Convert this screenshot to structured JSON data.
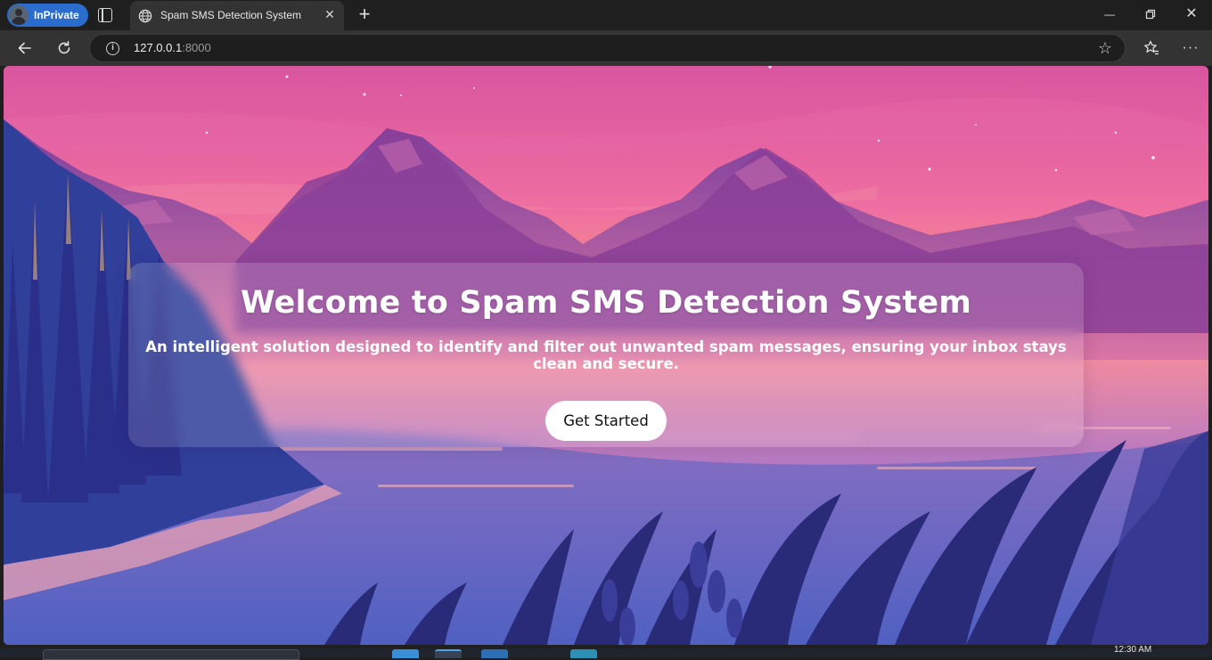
{
  "browser": {
    "inprivate_label": "InPrivate",
    "tab_title": "Spam SMS Detection System",
    "address": {
      "host": "127.0.0.1",
      "port": ":8000"
    }
  },
  "hero": {
    "title": "Welcome to Spam SMS Detection System",
    "subtitle": "An intelligent solution designed to identify and filter out unwanted spam messages, ensuring your inbox stays clean and secure.",
    "cta_label": "Get Started"
  },
  "taskbar": {
    "clock": "12:30 AM"
  },
  "icons": [
    "globe-icon",
    "close-icon",
    "plus-icon",
    "minimize-icon",
    "restore-icon",
    "back-icon",
    "refresh-icon",
    "info-icon",
    "star-icon",
    "favorites-icon",
    "more-icon"
  ],
  "colors": {
    "accent": "#2a6dcf",
    "sky_top": "#e45fa0",
    "sky_horizon": "#f6c65a",
    "mountains": "#8a3f9e",
    "water": "#5a6fc4"
  }
}
